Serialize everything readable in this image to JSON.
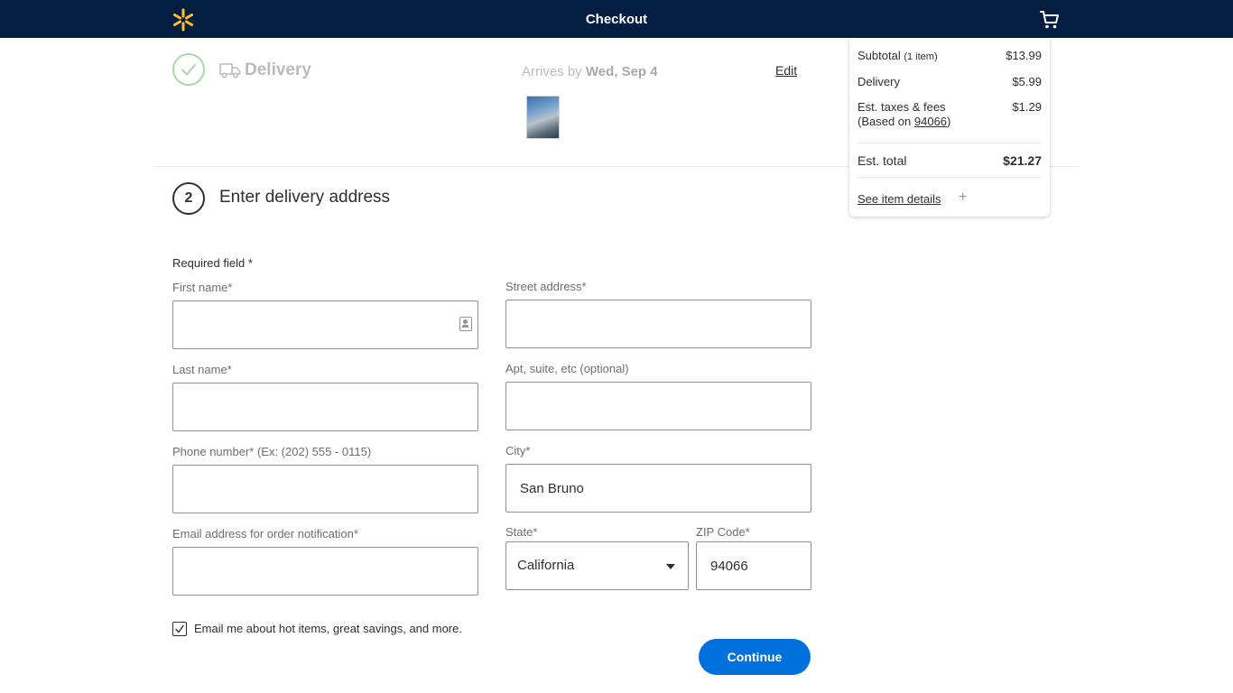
{
  "header": {
    "title": "Checkout",
    "logo_icon": "walmart-spark-icon",
    "cart_icon": "cart-icon",
    "background": "#041e42",
    "spark_color": "#ffc220"
  },
  "delivery": {
    "title": "Delivery",
    "arrives_prefix": "Arrives by",
    "arrives_date": "Wed, Sep 4",
    "edit_label": "Edit"
  },
  "step": {
    "number": "2",
    "title": "Enter delivery address"
  },
  "form": {
    "required_note": "Required field *",
    "first_name": {
      "label": "First name*",
      "value": ""
    },
    "last_name": {
      "label": "Last name*",
      "value": ""
    },
    "phone": {
      "label": "Phone number* (Ex: (202) 555 - 0115)",
      "value": ""
    },
    "email": {
      "label": "Email address for order notification*",
      "value": ""
    },
    "street": {
      "label": "Street address*",
      "value": ""
    },
    "apt": {
      "label": "Apt, suite, etc (optional)",
      "value": ""
    },
    "city": {
      "label": "City*",
      "value": "San Bruno"
    },
    "state": {
      "label": "State*",
      "value": "California"
    },
    "zip": {
      "label": "ZIP Code*",
      "value": "94066"
    },
    "email_opt_in": {
      "label": "Email me about hot items, great savings, and more.",
      "checked": true
    },
    "continue_label": "Continue",
    "accent": "#0071dc"
  },
  "summary": {
    "subtotal_label": "Subtotal",
    "subtotal_count": "(1 item)",
    "subtotal_value": "$13.99",
    "delivery_label": "Delivery",
    "delivery_value": "$5.99",
    "taxes_label": "Est. taxes & fees",
    "taxes_based_prefix": "(Based on",
    "taxes_based_zip": "94066",
    "taxes_based_suffix": ")",
    "taxes_value": "$1.29",
    "total_label": "Est. total",
    "total_value": "$21.27",
    "details_label": "See item details",
    "expand_symbol": "+"
  }
}
